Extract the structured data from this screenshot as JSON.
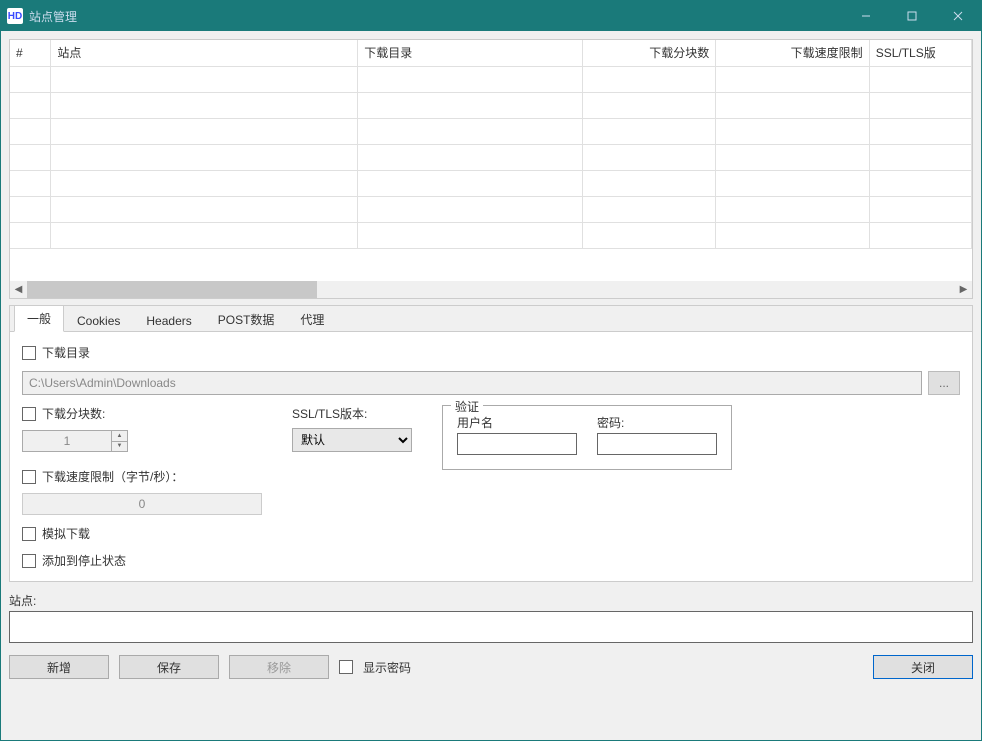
{
  "window": {
    "title": "站点管理"
  },
  "table": {
    "columns": {
      "index": "#",
      "site": "站点",
      "download_dir": "下载目录",
      "parts": "下载分块数",
      "speed_limit": "下载速度限制",
      "ssl_version": "SSL/TLS版"
    }
  },
  "tabs": {
    "general": "一般",
    "cookies": "Cookies",
    "headers": "Headers",
    "post_data": "POST数据",
    "proxy": "代理"
  },
  "general_tab": {
    "download_dir_label": "下载目录",
    "download_dir_value": "C:\\Users\\Admin\\Downloads",
    "browse_label": "...",
    "parts_label": "下载分块数:",
    "parts_value": "1",
    "ssl_label": "SSL/TLS版本:",
    "ssl_value": "默认",
    "auth_legend": "验证",
    "username_label": "用户名",
    "username_value": "",
    "password_label": "密码:",
    "password_value": "",
    "speed_limit_label": "下载速度限制（字节/秒）：",
    "speed_limit_value": "0",
    "simulate_label": "模拟下载",
    "add_stopped_label": "添加到停止状态"
  },
  "site_section": {
    "label": "站点:",
    "value": ""
  },
  "buttons": {
    "add": "新增",
    "save": "保存",
    "remove": "移除",
    "show_password": "显示密码",
    "close": "关闭"
  }
}
